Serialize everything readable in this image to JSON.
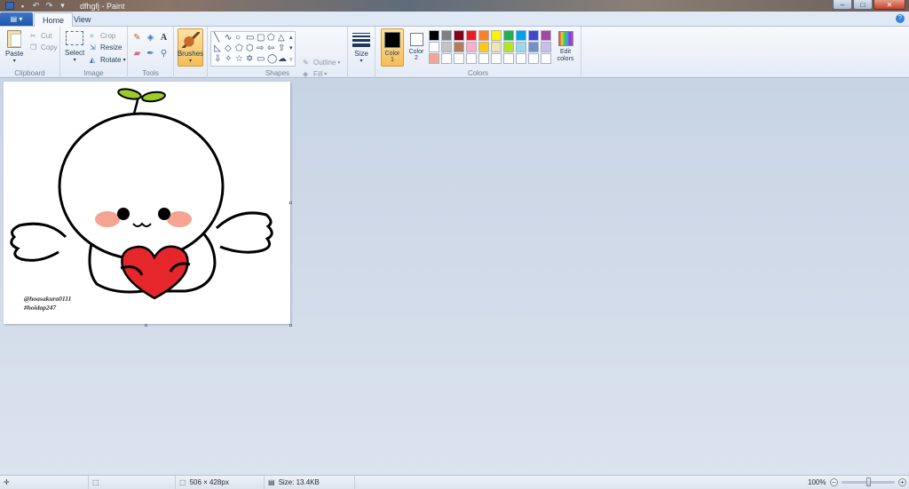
{
  "window": {
    "title": "dfhgfj - Paint"
  },
  "tabs": {
    "home": "Home",
    "view": "View"
  },
  "clipboard": {
    "paste": "Paste",
    "cut": "Cut",
    "copy": "Copy",
    "label": "Clipboard"
  },
  "image": {
    "select": "Select",
    "crop": "Crop",
    "resize": "Resize",
    "rotate": "Rotate",
    "label": "Image"
  },
  "tools": {
    "label": "Tools",
    "text_glyph": "A"
  },
  "brushes": {
    "label": "Brushes"
  },
  "shapes": {
    "outline": "Outline",
    "fill": "Fill",
    "label": "Shapes"
  },
  "size": {
    "label": "Size"
  },
  "colors": {
    "color1": "Color\n1",
    "color1_a": "Color",
    "color1_b": "1",
    "color2_a": "Color",
    "color2_b": "2",
    "edit_a": "Edit",
    "edit_b": "colors",
    "label": "Colors",
    "palette": [
      "#000000",
      "#7f7f7f",
      "#880015",
      "#ed1c24",
      "#ff7f27",
      "#fff200",
      "#22b14c",
      "#00a2e8",
      "#3f48cc",
      "#a349a4",
      "#ffffff",
      "#c3c3c3",
      "#b97a57",
      "#ffaec9",
      "#ffc90e",
      "#efe4b0",
      "#b5e61d",
      "#99d9ea",
      "#7092be",
      "#c8bfe7",
      "#f4a490",
      "#ffffff",
      "#ffffff",
      "#ffffff",
      "#ffffff",
      "#ffffff",
      "#ffffff",
      "#ffffff",
      "#ffffff",
      "#ffffff"
    ]
  },
  "canvas": {
    "credit_line1": "@hoasakura0111",
    "credit_line2": "#hoidap247"
  },
  "status": {
    "dimensions": "506 × 428px",
    "size": "Size: 13.4KB",
    "zoom": "100%"
  }
}
